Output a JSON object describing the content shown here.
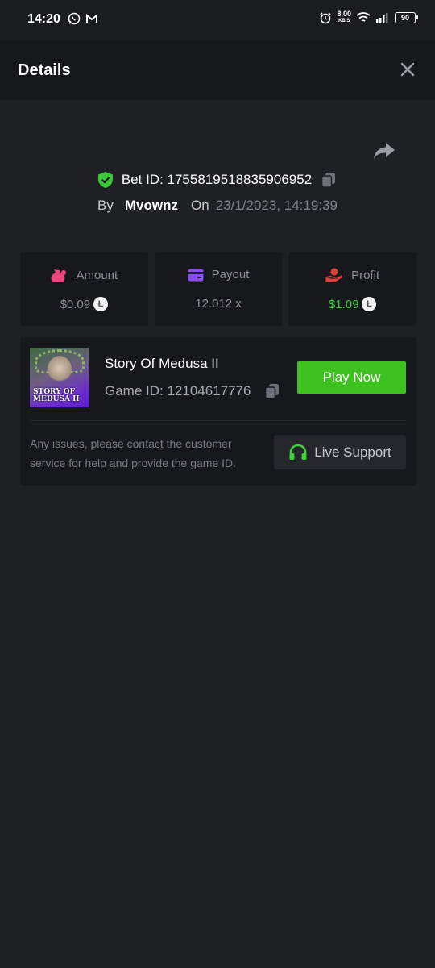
{
  "status_bar": {
    "time": "14:20",
    "net_speed": "8.00",
    "net_unit": "KB/S",
    "battery": "90"
  },
  "header": {
    "title": "Details"
  },
  "bet": {
    "id_label": "Bet ID: 1755819518835906952",
    "by_label": "By",
    "user": "Mvownz",
    "on_label": "On",
    "date": "23/1/2023, 14:19:39"
  },
  "stats": {
    "amount": {
      "label": "Amount",
      "value": "$0.09",
      "icon": "money-bag-icon",
      "color": "#e8467c"
    },
    "payout": {
      "label": "Payout",
      "value": "12.012 x",
      "icon": "card-icon",
      "color": "#8b4cf5"
    },
    "profit": {
      "label": "Profit",
      "value": "$1.09",
      "icon": "hand-coin-icon",
      "color": "#e0403a"
    }
  },
  "game": {
    "thumb_text_line1": "STORY OF",
    "thumb_text_line2": "MEDUSA II",
    "name": "Story Of Medusa II",
    "id_label": "Game ID: 12104617776",
    "play_label": "Play Now",
    "support_text": "Any issues, please contact the customer service for help and provide the game ID.",
    "support_label": "Live Support"
  },
  "colors": {
    "accent_green": "#3dc11f",
    "profit_green": "#3fce3a",
    "background": "#1f2024",
    "card": "#17181b"
  }
}
